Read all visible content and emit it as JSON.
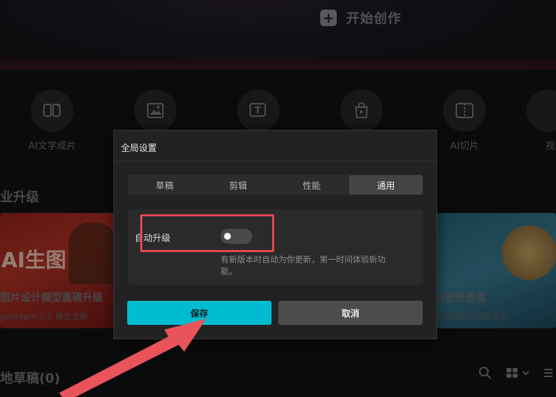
{
  "hero": {
    "start_label": "开始创作"
  },
  "tools": [
    {
      "label": "AI文字成片",
      "icon": "ai-text-video-icon"
    },
    {
      "label": "",
      "icon": "image-icon"
    },
    {
      "label": "",
      "icon": "text-icon"
    },
    {
      "label": "",
      "icon": "shopping-bag-icon"
    },
    {
      "label": "",
      "icon": "ai-cut-icon"
    },
    {
      "label": "AI切片",
      "icon": "ai-cut-icon"
    },
    {
      "label": "视",
      "icon": "video-icon"
    }
  ],
  "section": {
    "title": "业升级"
  },
  "cards": {
    "left": {
      "big": "AI生图",
      "title": "图片设计模型重磅升级",
      "subtitle": "eedream 5.0 模型全新"
    },
    "right": {
      "title": "材变形透视",
      "subtitle": "由拖拽素材边角变形"
    }
  },
  "drafts": {
    "title": "地草稿(0)"
  },
  "dialog": {
    "title": "全局设置",
    "tabs": [
      {
        "label": "草稿",
        "active": false
      },
      {
        "label": "剪辑",
        "active": false
      },
      {
        "label": "性能",
        "active": false
      },
      {
        "label": "通用",
        "active": true
      }
    ],
    "auto_upgrade": {
      "label": "自动升级",
      "enabled": false,
      "description": "有新版本时自动为你更新，第一时间体验新功能。"
    },
    "save_label": "保存",
    "cancel_label": "取消"
  },
  "colors": {
    "accent": "#00bcd0",
    "highlight": "#e8484f",
    "arrow": "#e9535a"
  }
}
